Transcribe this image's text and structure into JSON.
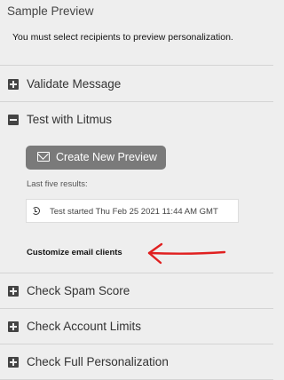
{
  "preview": {
    "title": "Sample Preview",
    "message": "You must select recipients to preview personalization."
  },
  "sections": {
    "validate": "Validate Message",
    "litmus": "Test with Litmus",
    "spam": "Check Spam Score",
    "limits": "Check Account Limits",
    "personalization": "Check Full Personalization"
  },
  "litmus": {
    "create_button": "Create New Preview",
    "last_results_label": "Last five results:",
    "results": [
      "Test started Thu Feb 25 2021 11:44 AM GMT"
    ],
    "customize_link": "Customize email clients"
  },
  "colors": {
    "annotation_arrow": "#e02020",
    "button_bg": "#7a7a7a",
    "panel_bg": "#eeeeee"
  }
}
